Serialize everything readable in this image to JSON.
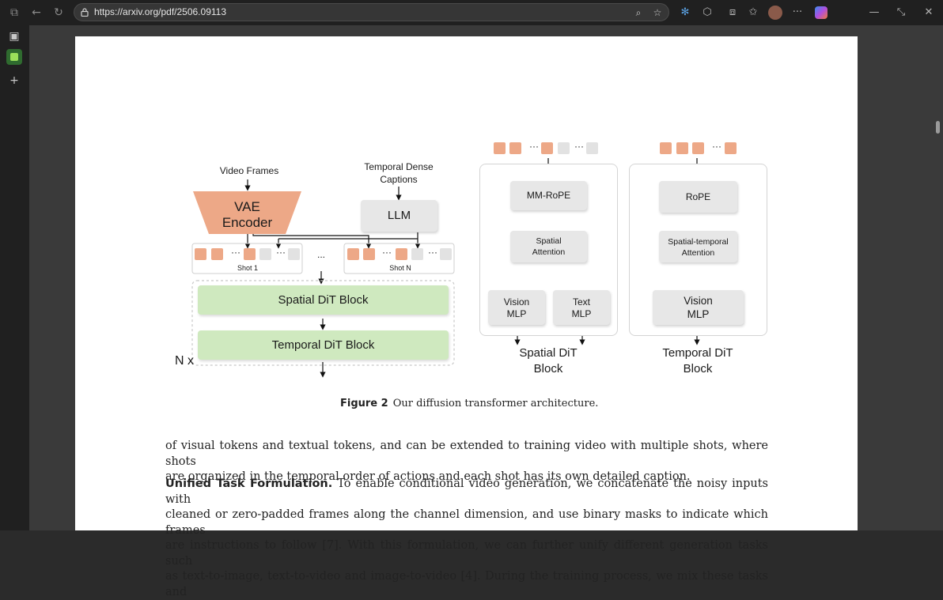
{
  "browser": {
    "url": "https://arxiv.org/pdf/2506.09113",
    "icons": [
      "back-icon",
      "refresh-icon",
      "lock-icon",
      "zoom-icon",
      "favorite-star-icon",
      "extension-icon",
      "browser-essentials-icon",
      "split-screen-icon",
      "favorites-icon",
      "profile-avatar",
      "more-icon",
      "copilot-icon",
      "minimize-icon",
      "restore-icon",
      "close-icon"
    ]
  },
  "sidebar": {
    "icons": [
      "tab-actions-icon",
      "workspace-icon",
      "add-icon"
    ]
  },
  "figure": {
    "video_frames": "Video Frames",
    "temporal_dense": "Temporal Dense",
    "captions": "Captions",
    "vae": "VAE",
    "encoder": "Encoder",
    "llm": "LLM",
    "shot1": "Shot 1",
    "shotn": "Shot N",
    "ellipsis": "...",
    "token_dots": "···",
    "spatial_dit_block": "Spatial DiT Block",
    "temporal_dit_block": "Temporal DiT Block",
    "nx": "N x",
    "mm_rope": "MM-RoPE",
    "spatial_attention_1": "Spatial",
    "spatial_attention_2": "Attention",
    "vision_1": "Vision",
    "mlp": "MLP",
    "text_1": "Text",
    "spatial_dit_1": "Spatial DiT",
    "block": "Block",
    "rope": "RoPE",
    "st_attention_1": "Spatial-temporal",
    "st_attention_2": "Attention",
    "temporal_dit_1": "Temporal DiT",
    "caption_label": "Figure 2",
    "caption_text": "Our diffusion transformer architecture."
  },
  "body": {
    "para1_line1": "of visual tokens and textual tokens, and can be extended to training video with multiple shots, where shots",
    "para1_line2": "are organized in the temporal order of actions and each shot has its own detailed caption.",
    "para2_head": "Unified Task Formulation.",
    "para2_line1": " To enable conditional video generation, we concatenate the noisy inputs with",
    "para2_line2": "cleaned or zero-padded frames along the channel dimension, and use binary masks to indicate which frames",
    "para2_line3": "are instructions to follow [7].  With this formulation, we can further unify different generation tasks such",
    "para2_line4": "as text-to-image, text-to-video and image-to-video [4].  During the training process, we mix these tasks and"
  },
  "colors": {
    "token_orange": "#eda887",
    "token_gray": "#e2e2e2",
    "vae_fill": "#eda887",
    "dit_green": "#cfe9bf"
  }
}
